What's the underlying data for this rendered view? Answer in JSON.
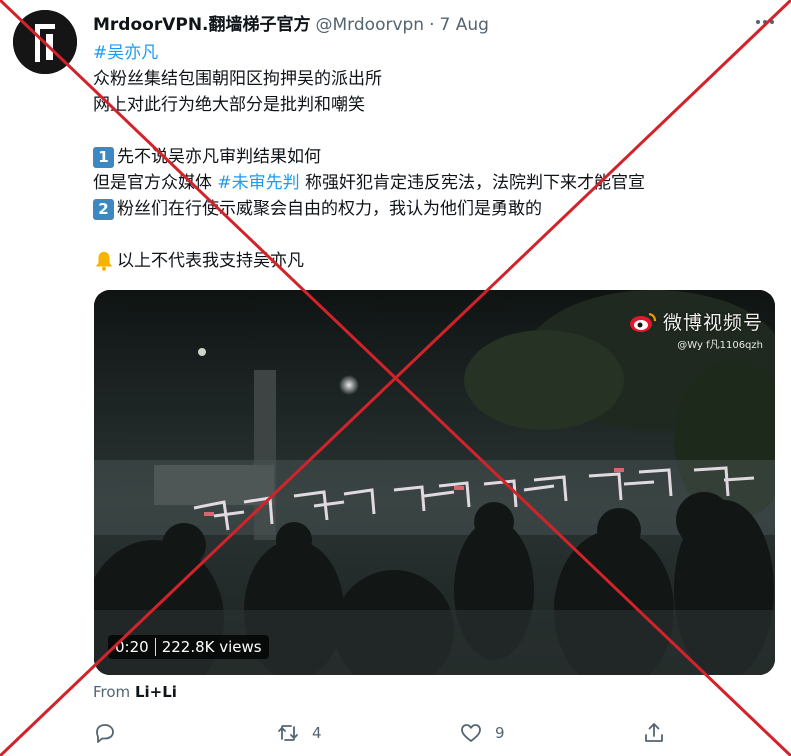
{
  "tweet": {
    "display_name": "MrdoorVPN.翻墙梯子官方",
    "handle": "@Mrdoorvpn",
    "separator": "·",
    "date": "7 Aug",
    "hashtag": "#吴亦凡",
    "line1": "众粉丝集结包围朝阳区拘押吴的派出所",
    "line2": "网上对此行为绝大部分是批判和嘲笑",
    "badge1": "1",
    "line3": "先不说吴亦凡审判结果如何",
    "line4_before": "但是官方众媒体 ",
    "line4_tag": "#未审先判",
    "line4_after": " 称强奸犯肯定违反宪法，法院判下来才能官宣",
    "badge2": "2",
    "line5": "粉丝们在行使示威聚会自由的权力，我认为他们是勇敢的",
    "line6": "以上不代表我支持吴亦凡"
  },
  "media": {
    "watermark_name": "微博视频号",
    "watermark_handle": "@Wy f凡1106qzh",
    "duration": "0:20",
    "views": "222.8K views"
  },
  "source": {
    "prefix": "From ",
    "name": "Li+Li"
  },
  "actions": {
    "reply_count": "",
    "retweet_count": "4",
    "like_count": "9"
  },
  "icons": {
    "avatar": "door-logo-icon",
    "more": "more-icon",
    "reply": "reply-icon",
    "retweet": "retweet-icon",
    "like": "heart-icon",
    "share": "share-icon",
    "bell": "bell-icon",
    "weibo": "weibo-eye-icon"
  },
  "colors": {
    "link": "#1d9bf0",
    "secondary": "#536471",
    "cross": "#d2232a",
    "badge": "#3b88c3"
  }
}
